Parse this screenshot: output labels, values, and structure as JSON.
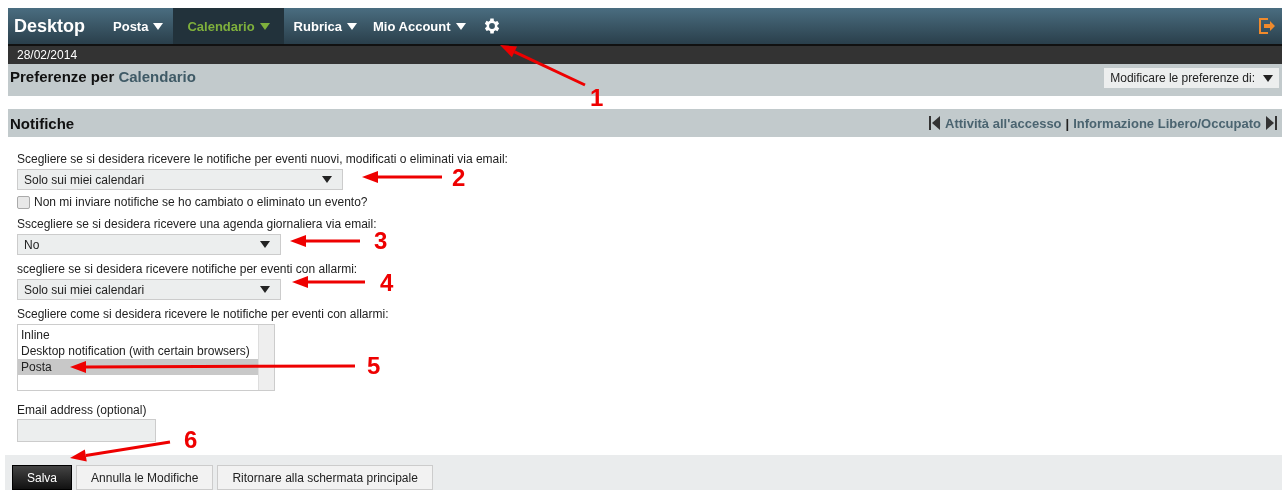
{
  "nav": {
    "brand": "Desktop",
    "items": [
      {
        "label": "Posta",
        "selected": false
      },
      {
        "label": "Calendario",
        "selected": true
      },
      {
        "label": "Rubrica",
        "selected": false
      },
      {
        "label": "Mio Account",
        "selected": false
      }
    ]
  },
  "date": "28/02/2014",
  "header": {
    "title": "Preferenze per",
    "app": "Calendario",
    "scope_select": "Modificare le preferenze di:"
  },
  "section": {
    "title": "Notifiche",
    "prev_link": "Attività all'accesso",
    "separator": "|",
    "next_link": "Informazione Libero/Occupato"
  },
  "form": [
    {
      "kind": "select",
      "label": "Scegliere se si desidera ricevere le notifiche per eventi nuovi, modificati o eliminati via email:",
      "value": "Solo sui miei calendari"
    },
    {
      "kind": "checkbox",
      "label": "Non mi inviare notifiche se ho cambiato o eliminato un evento?",
      "checked": false
    },
    {
      "kind": "select",
      "label": "Sscegliere se si desidera ricevere una agenda giornaliera via email:",
      "value": "No"
    },
    {
      "kind": "select",
      "label": "scegliere se si desidera ricevere notifiche per eventi con allarmi:",
      "value": "Solo sui miei calendari"
    },
    {
      "kind": "listbox",
      "label": "Scegliere come si desidera ricevere le notifiche per eventi con allarmi:",
      "options": [
        {
          "label": "Inline",
          "selected": false
        },
        {
          "label": "Desktop notification (with certain browsers)",
          "selected": false
        },
        {
          "label": "Posta",
          "selected": true
        }
      ]
    },
    {
      "kind": "input",
      "label": "Email address (optional)"
    }
  ],
  "buttons": [
    {
      "label": "Salva",
      "kind": "primary"
    },
    {
      "label": "Annulla le Modifiche",
      "kind": "secondary"
    },
    {
      "label": "Ritornare alla schermata principale",
      "kind": "secondary"
    }
  ],
  "annotations": [
    "1",
    "2",
    "3",
    "4",
    "5",
    "6"
  ]
}
